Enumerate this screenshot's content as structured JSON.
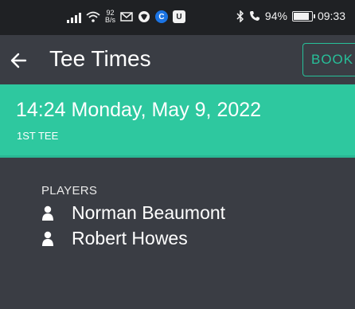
{
  "status_bar": {
    "net_speed_value": "92",
    "net_speed_unit": "B/s",
    "battery": "94%",
    "battery_level": 0.94,
    "time": "09:33",
    "icons": [
      "signal-icon",
      "wifi-icon",
      "mail-icon",
      "vpn-icon",
      "browser-icon",
      "u-app-icon",
      "bluetooth-icon",
      "call-icon",
      "battery-icon"
    ]
  },
  "app_bar": {
    "title": "Tee Times",
    "book_label": "BOOK",
    "back_icon": "arrow-left-icon"
  },
  "banner": {
    "datetime": "14:24 Monday, May 9, 2022",
    "tee": "1ST TEE",
    "color": "#2ec89f"
  },
  "players": {
    "label": "PLAYERS",
    "items": [
      {
        "name": "Norman Beaumont",
        "icon": "person-icon"
      },
      {
        "name": "Robert Howes",
        "icon": "person-icon"
      }
    ]
  },
  "colors": {
    "background": "#3a3d44",
    "status_bar": "#1f2124",
    "accent": "#27c09a"
  }
}
